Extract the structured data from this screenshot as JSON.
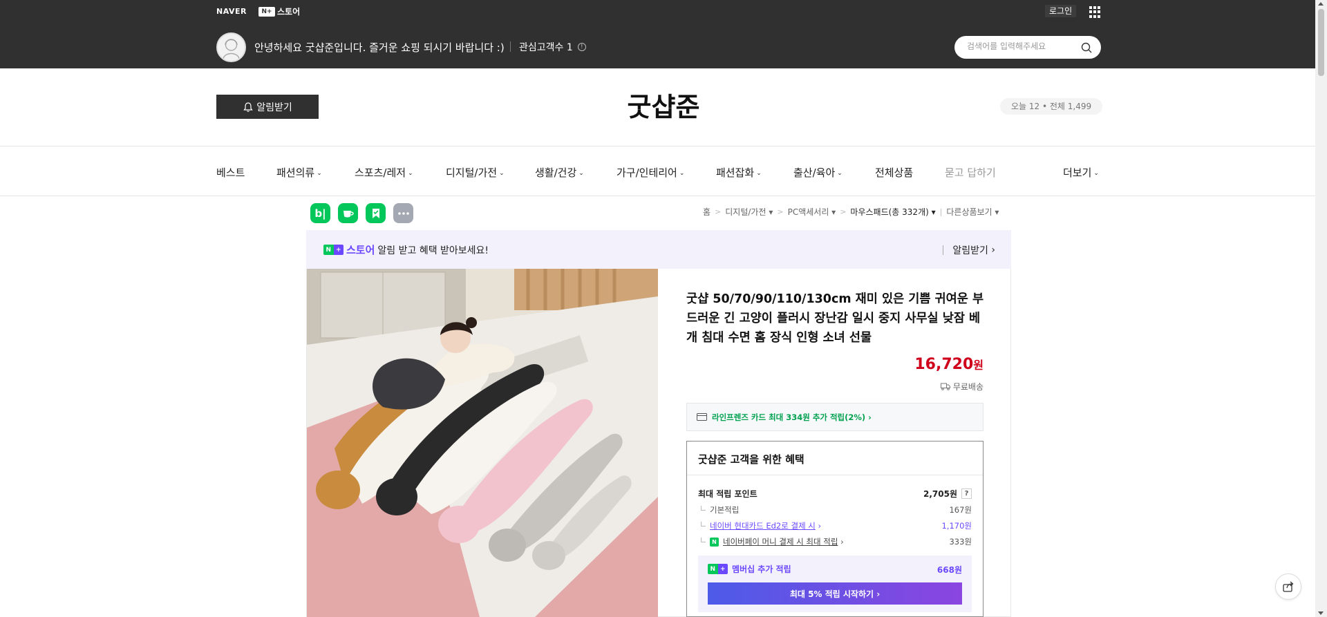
{
  "topbar": {
    "naver": "NAVER",
    "nplus_box": "N+",
    "nplus_store": "스토어",
    "login": "로그인",
    "greeting": "안녕하세요 굿샵준입니다. 즐거운 쇼핑 되시기 바랍니다 :)",
    "fav_label": "관심고객수 1",
    "search_placeholder": "검색어를 입력해주세요"
  },
  "header": {
    "alarm_button": "알림받기",
    "store_name": "굿샵준",
    "visits": "오늘 12 • 전체 1,499"
  },
  "nav": {
    "items": [
      {
        "label": "베스트"
      },
      {
        "label": "패션의류"
      },
      {
        "label": "스포츠/레저"
      },
      {
        "label": "디지털/가전"
      },
      {
        "label": "생활/건강"
      },
      {
        "label": "가구/인테리어"
      },
      {
        "label": "패션잡화"
      },
      {
        "label": "출산/육아"
      },
      {
        "label": "전체상품"
      },
      {
        "label": "묻고 답하기"
      },
      {
        "label": "더보기"
      }
    ]
  },
  "share": {
    "blog": "b|"
  },
  "breadcrumb": {
    "home": "홈",
    "cat1": "디지털/가전",
    "cat2": "PC액세서리",
    "cat3": "마우스패드(총 332개)",
    "other": "다른상품보기"
  },
  "banner": {
    "store": "스토어",
    "text": "알림 받고 혜택 받아보세요!",
    "right": "알림받기"
  },
  "product": {
    "title": "굿샵 50/70/90/110/130cm 재미 있은 기쁨 귀여운 부드러운 긴 고양이 플러시 장난감 일시 중지 사무실 낮잠 베개 침대 수면 홈 장식 인형 소녀 선물",
    "price": "16,720",
    "price_unit": "원",
    "shipping": "무료배송",
    "card_offer": "라인프렌즈 카드 최대 334원 추가 적립(2%) ›"
  },
  "benefit": {
    "title": "굿샵준 고객을 위한 혜택",
    "max_points_label": "최대 적립 포인트",
    "max_points_value": "2,705원",
    "q": "?",
    "base_label": "기본적립",
    "base_value": "167원",
    "card_label": "네이버 현대카드 Ed2로 결제 시",
    "card_value": "1,170원",
    "pay_label": "네이버페이 머니 결제 시 최대 적립",
    "pay_value": "333원",
    "member_label": "멤버십 추가 적립",
    "member_value": "668원",
    "member_button": "최대 5% 적립 시작하기 ›"
  },
  "colors": {
    "topbar": "#303030",
    "price": "#d0021b",
    "naver_green": "#03c75a",
    "npay_purple": "#6b48ff"
  }
}
